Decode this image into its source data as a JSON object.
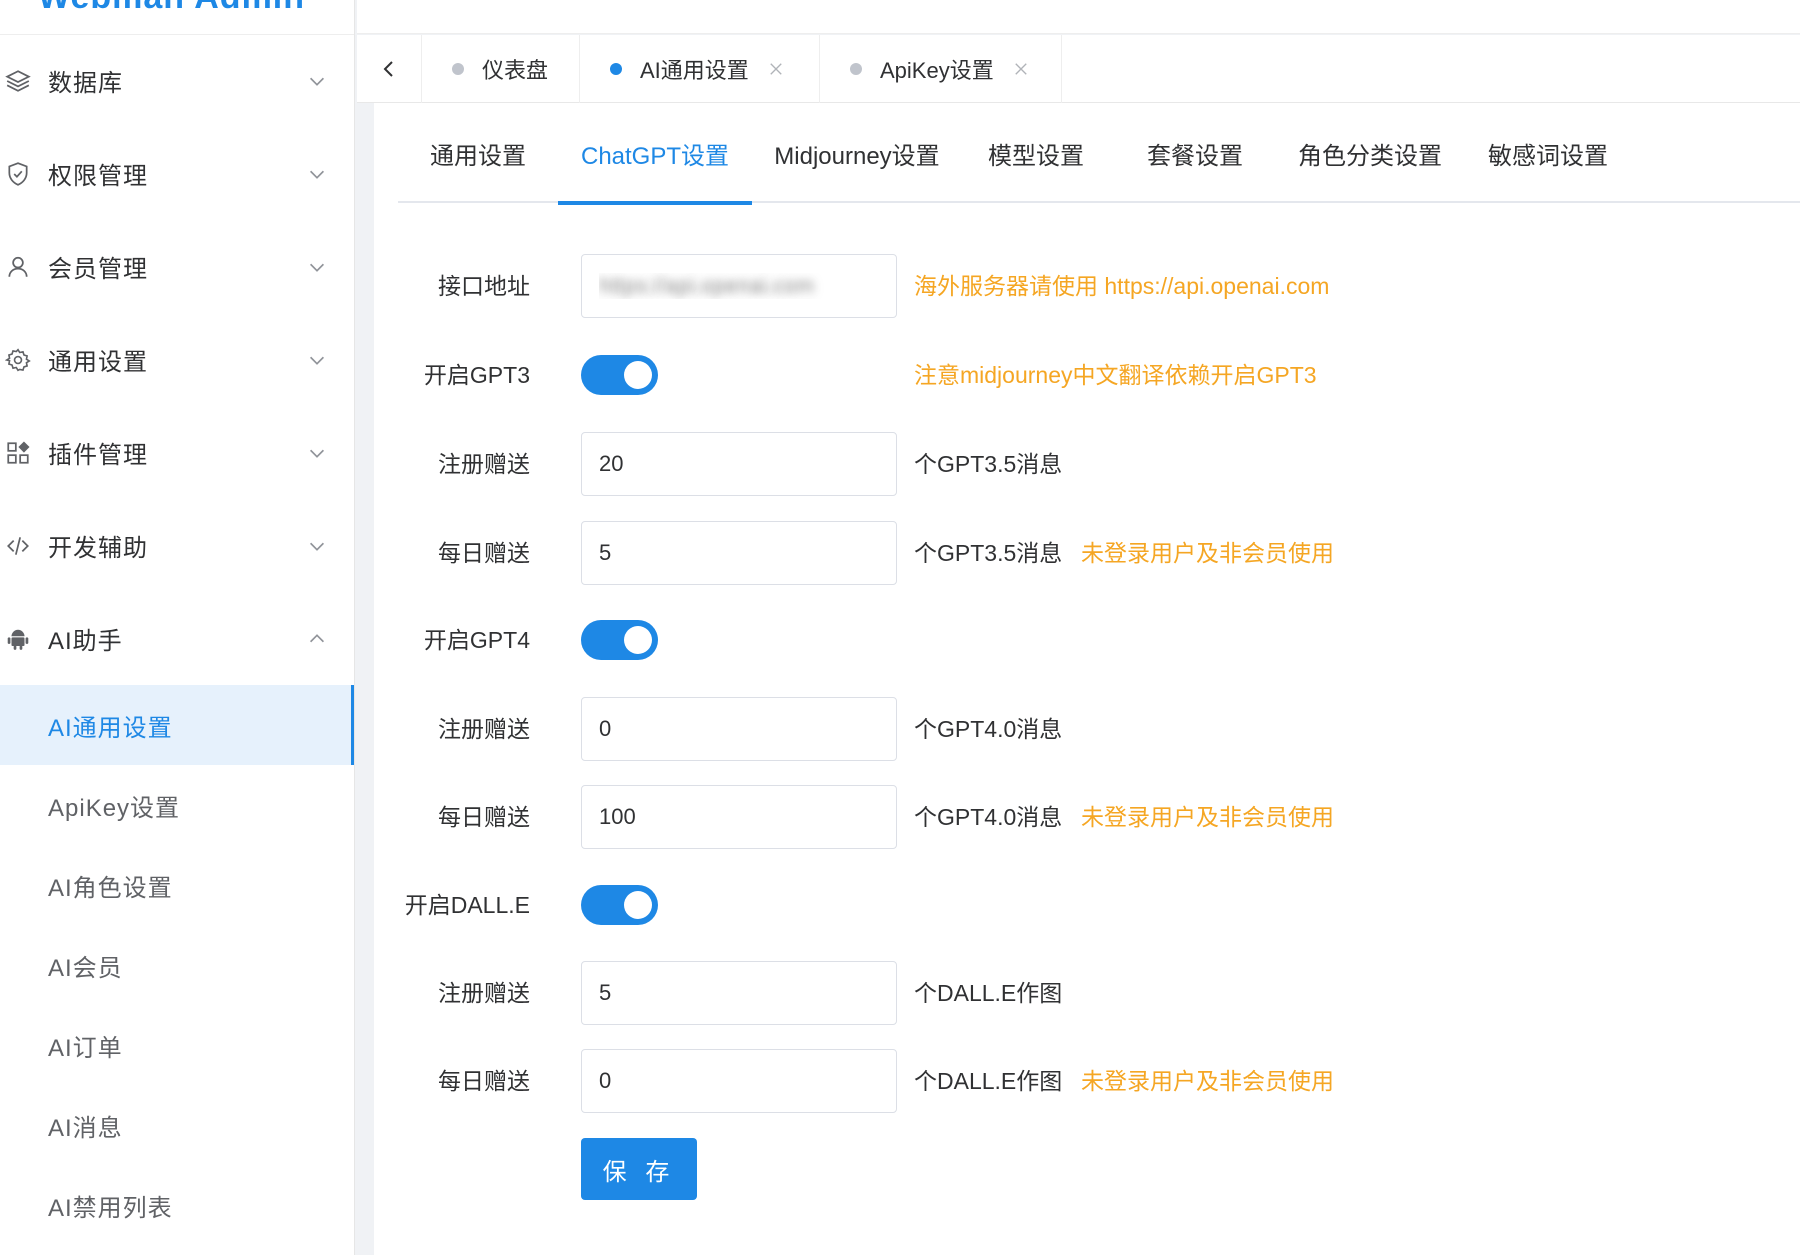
{
  "app": {
    "title": "Webman Admin"
  },
  "colors": {
    "accent": "#1e88e5",
    "hint": "#f5a623"
  },
  "sidebar": {
    "menus": [
      {
        "label": "数据库",
        "icon": "layers-icon"
      },
      {
        "label": "权限管理",
        "icon": "shield-check-icon"
      },
      {
        "label": "会员管理",
        "icon": "user-icon"
      },
      {
        "label": "通用设置",
        "icon": "gear-icon"
      },
      {
        "label": "插件管理",
        "icon": "apps-icon"
      },
      {
        "label": "开发辅助",
        "icon": "code-icon"
      },
      {
        "label": "AI助手",
        "icon": "android-icon"
      }
    ],
    "ai_items": [
      {
        "label": "AI通用设置"
      },
      {
        "label": "ApiKey设置"
      },
      {
        "label": "AI角色设置"
      },
      {
        "label": "AI会员"
      },
      {
        "label": "AI订单"
      },
      {
        "label": "AI消息"
      },
      {
        "label": "AI禁用列表"
      }
    ]
  },
  "page_tabs": [
    {
      "label": "仪表盘"
    },
    {
      "label": "AI通用设置"
    },
    {
      "label": "ApiKey设置"
    }
  ],
  "sub_tabs": [
    "通用设置",
    "ChatGPT设置",
    "Midjourney设置",
    "模型设置",
    "套餐设置",
    "角色分类设置",
    "敏感词设置"
  ],
  "form": {
    "api_url": {
      "label": "接口地址",
      "value": "https://api.openai.com",
      "hint": "海外服务器请使用 https://api.openai.com"
    },
    "gpt3": {
      "label": "开启GPT3",
      "enabled": true,
      "hint": "注意midjourney中文翻译依赖开启GPT3"
    },
    "gpt35_register": {
      "label": "注册赠送",
      "value": "20",
      "suffix": "个GPT3.5消息"
    },
    "gpt35_daily": {
      "label": "每日赠送",
      "value": "5",
      "suffix": "个GPT3.5消息",
      "hint": "未登录用户及非会员使用"
    },
    "gpt4": {
      "label": "开启GPT4",
      "enabled": true
    },
    "gpt4_register": {
      "label": "注册赠送",
      "value": "0",
      "suffix": "个GPT4.0消息"
    },
    "gpt4_daily": {
      "label": "每日赠送",
      "value": "100",
      "suffix": "个GPT4.0消息",
      "hint": "未登录用户及非会员使用"
    },
    "dalle": {
      "label": "开启DALL.E",
      "enabled": true
    },
    "dalle_register": {
      "label": "注册赠送",
      "value": "5",
      "suffix": "个DALL.E作图"
    },
    "dalle_daily": {
      "label": "每日赠送",
      "value": "0",
      "suffix": "个DALL.E作图",
      "hint": "未登录用户及非会员使用"
    },
    "save_label": "保 存"
  }
}
